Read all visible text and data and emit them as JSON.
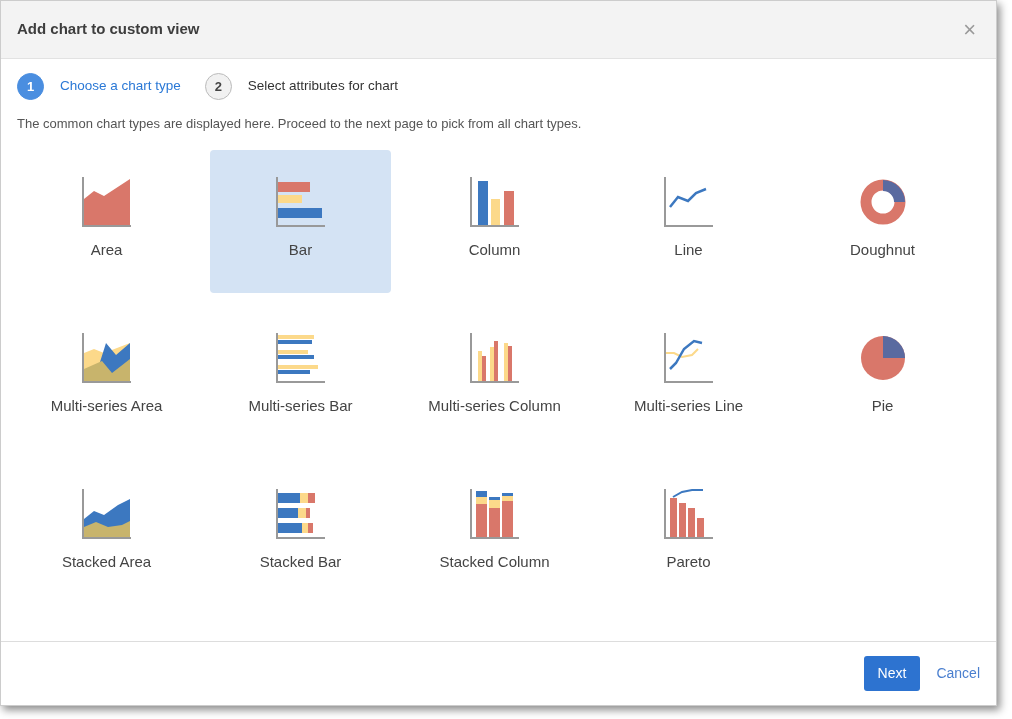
{
  "dialog": {
    "title": "Add chart to custom view",
    "close": "×"
  },
  "steps": [
    {
      "number": "1",
      "label": "Choose a chart type",
      "selected": true
    },
    {
      "number": "2",
      "label": "Select attributes for chart",
      "selected": false
    }
  ],
  "description": "The common chart types are displayed here. Proceed to the next page to pick from all chart types.",
  "chart_types": [
    {
      "label": "Area",
      "kind": "area",
      "selected": false
    },
    {
      "label": "Bar",
      "kind": "bar",
      "selected": true
    },
    {
      "label": "Column",
      "kind": "column",
      "selected": false
    },
    {
      "label": "Line",
      "kind": "line",
      "selected": false
    },
    {
      "label": "Doughnut",
      "kind": "doughnut",
      "selected": false
    },
    {
      "label": "Multi-series Area",
      "kind": "multi_area",
      "selected": false
    },
    {
      "label": "Multi-series Bar",
      "kind": "multi_bar",
      "selected": false
    },
    {
      "label": "Multi-series Column",
      "kind": "multi_column",
      "selected": false
    },
    {
      "label": "Multi-series Line",
      "kind": "multi_line",
      "selected": false
    },
    {
      "label": "Pie",
      "kind": "pie",
      "selected": false
    },
    {
      "label": "Stacked Area",
      "kind": "stacked_area",
      "selected": false
    },
    {
      "label": "Stacked Bar",
      "kind": "stacked_bar",
      "selected": false
    },
    {
      "label": "Stacked Column",
      "kind": "stacked_column",
      "selected": false
    },
    {
      "label": "Pareto",
      "kind": "pareto",
      "selected": false
    }
  ],
  "buttons": {
    "next": "Next",
    "cancel": "Cancel"
  }
}
